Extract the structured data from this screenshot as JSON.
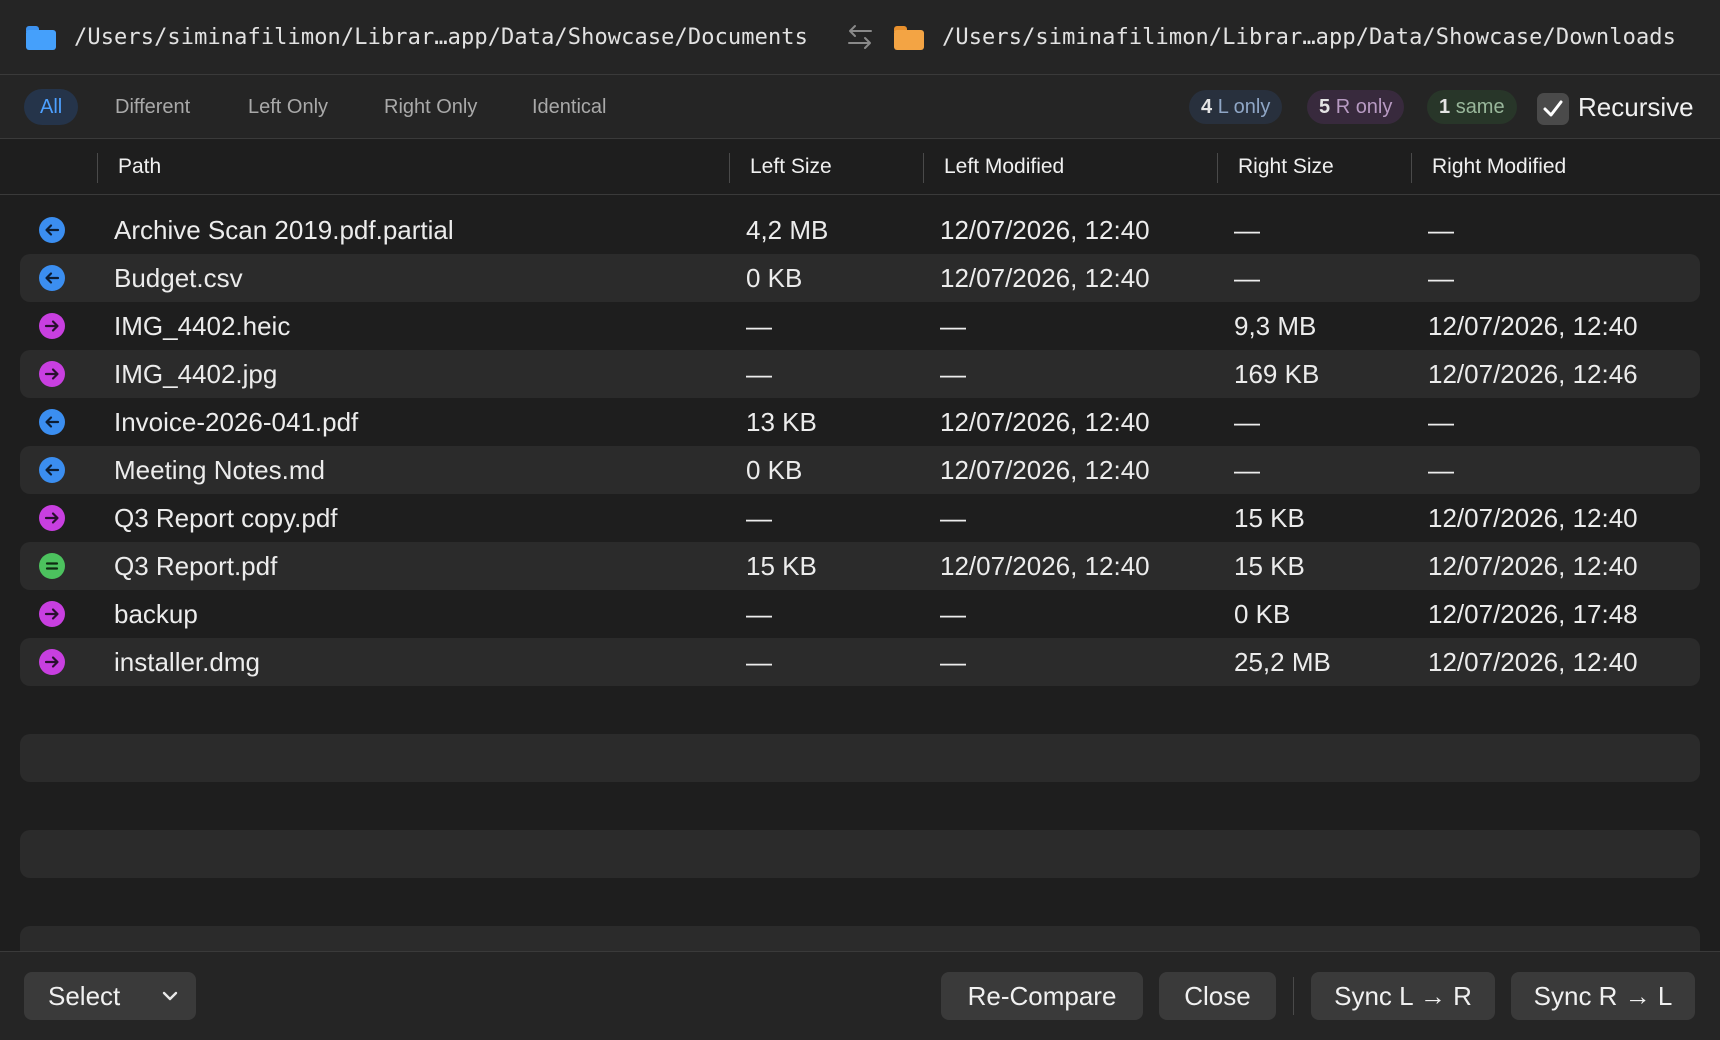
{
  "paths": {
    "left": "/Users/siminafilimon/Librar…app/Data/Showcase/Documents",
    "right": "/Users/siminafilimon/Librar…app/Data/Showcase/Downloads"
  },
  "filters": [
    "All",
    "Different",
    "Left Only",
    "Right Only",
    "Identical"
  ],
  "active_filter": "All",
  "summary": {
    "left_only_count": "4",
    "left_only_label": "L only",
    "right_only_count": "5",
    "right_only_label": "R only",
    "same_count": "1",
    "same_label": "same"
  },
  "recursive": {
    "label": "Recursive",
    "checked": true
  },
  "columns": {
    "path": "Path",
    "left_size": "Left Size",
    "left_modified": "Left Modified",
    "right_size": "Right Size",
    "right_modified": "Right Modified"
  },
  "rows": [
    {
      "status": "left-only",
      "path": "Archive Scan 2019.pdf.partial",
      "left_size": "4,2 MB",
      "left_modified": "12/07/2026, 12:40",
      "right_size": "—",
      "right_modified": "—"
    },
    {
      "status": "left-only",
      "path": "Budget.csv",
      "left_size": "0 KB",
      "left_modified": "12/07/2026, 12:40",
      "right_size": "—",
      "right_modified": "—"
    },
    {
      "status": "right-only",
      "path": "IMG_4402.heic",
      "left_size": "—",
      "left_modified": "—",
      "right_size": "9,3 MB",
      "right_modified": "12/07/2026, 12:40"
    },
    {
      "status": "right-only",
      "path": "IMG_4402.jpg",
      "left_size": "—",
      "left_modified": "—",
      "right_size": "169 KB",
      "right_modified": "12/07/2026, 12:46"
    },
    {
      "status": "left-only",
      "path": "Invoice-2026-041.pdf",
      "left_size": "13 KB",
      "left_modified": "12/07/2026, 12:40",
      "right_size": "—",
      "right_modified": "—"
    },
    {
      "status": "left-only",
      "path": "Meeting Notes.md",
      "left_size": "0 KB",
      "left_modified": "12/07/2026, 12:40",
      "right_size": "—",
      "right_modified": "—"
    },
    {
      "status": "right-only",
      "path": "Q3 Report copy.pdf",
      "left_size": "—",
      "left_modified": "—",
      "right_size": "15 KB",
      "right_modified": "12/07/2026, 12:40"
    },
    {
      "status": "identical",
      "path": "Q3 Report.pdf",
      "left_size": "15 KB",
      "left_modified": "12/07/2026, 12:40",
      "right_size": "15 KB",
      "right_modified": "12/07/2026, 12:40"
    },
    {
      "status": "right-only",
      "path": "backup",
      "left_size": "—",
      "left_modified": "—",
      "right_size": "0 KB",
      "right_modified": "12/07/2026, 17:48"
    },
    {
      "status": "right-only",
      "path": "installer.dmg",
      "left_size": "—",
      "left_modified": "—",
      "right_size": "25,2 MB",
      "right_modified": "12/07/2026, 12:40"
    }
  ],
  "status_colors": {
    "left-only": "#3b8ef0",
    "right-only": "#c83fe0",
    "identical": "#4cc25e"
  },
  "status_icons": {
    "left-only": "arrow-left-icon",
    "right-only": "arrow-right-icon",
    "identical": "equals-icon"
  },
  "footer": {
    "select_label": "Select",
    "recompare_label": "Re-Compare",
    "close_label": "Close",
    "sync_lr_label": "Sync L → R",
    "sync_rl_label": "Sync R → L"
  }
}
